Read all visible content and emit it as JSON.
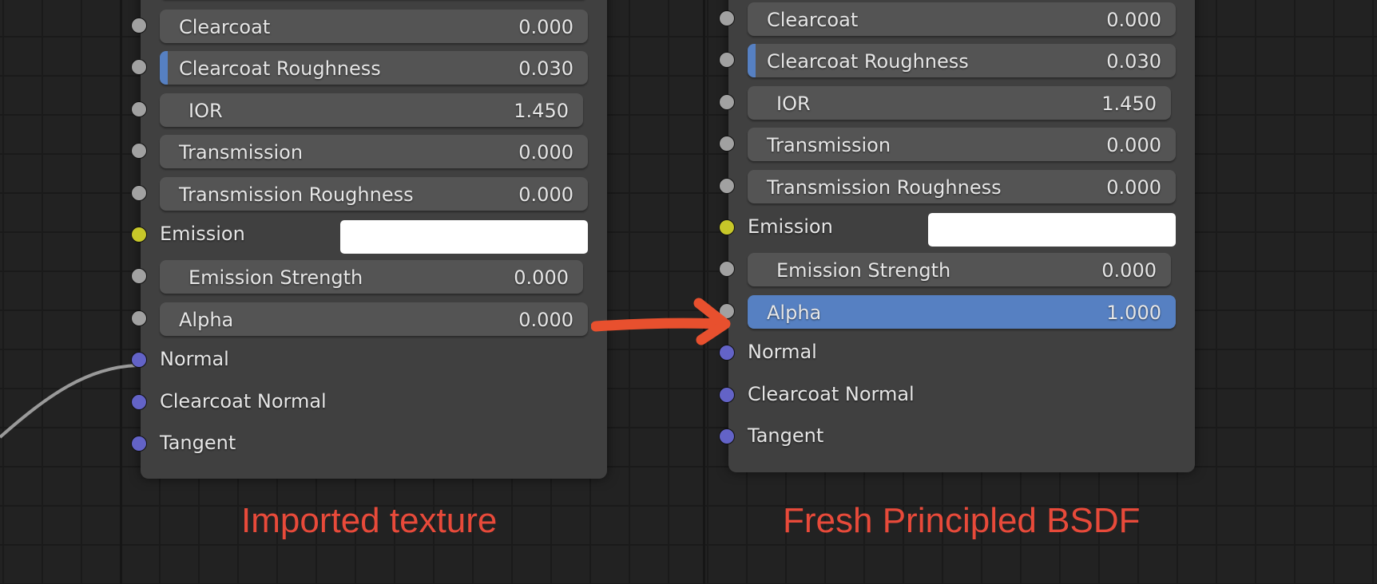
{
  "nodes": [
    {
      "name": "Imported texture node",
      "top_slider_fill_fraction": 0.5,
      "inputs": [
        {
          "label": "Clearcoat",
          "value": "0.000",
          "socket": "gray",
          "kind": "slider",
          "fill": 0.0
        },
        {
          "label": "Clearcoat Roughness",
          "value": "0.030",
          "socket": "gray",
          "kind": "slider",
          "fill": 0.03
        },
        {
          "label": "IOR",
          "value": "1.450",
          "socket": "gray",
          "kind": "number"
        },
        {
          "label": "Transmission",
          "value": "0.000",
          "socket": "gray",
          "kind": "slider",
          "fill": 0.0
        },
        {
          "label": "Transmission Roughness",
          "value": "0.000",
          "socket": "gray",
          "kind": "slider",
          "fill": 0.0
        },
        {
          "label": "Emission",
          "value": "#ffffff",
          "socket": "yellow",
          "kind": "color"
        },
        {
          "label": "Emission Strength",
          "value": "0.000",
          "socket": "gray",
          "kind": "number"
        },
        {
          "label": "Alpha",
          "value": "0.000",
          "socket": "gray",
          "kind": "slider",
          "fill": 0.0
        },
        {
          "label": "Normal",
          "socket": "purple",
          "kind": "vector"
        },
        {
          "label": "Clearcoat Normal",
          "socket": "purple",
          "kind": "vector"
        },
        {
          "label": "Tangent",
          "socket": "purple",
          "kind": "vector"
        }
      ]
    },
    {
      "name": "Fresh Principled BSDF node",
      "top_slider_fill_fraction": 0.5,
      "inputs": [
        {
          "label": "Clearcoat",
          "value": "0.000",
          "socket": "gray",
          "kind": "slider",
          "fill": 0.0
        },
        {
          "label": "Clearcoat Roughness",
          "value": "0.030",
          "socket": "gray",
          "kind": "slider",
          "fill": 0.03
        },
        {
          "label": "IOR",
          "value": "1.450",
          "socket": "gray",
          "kind": "number"
        },
        {
          "label": "Transmission",
          "value": "0.000",
          "socket": "gray",
          "kind": "slider",
          "fill": 0.0
        },
        {
          "label": "Transmission Roughness",
          "value": "0.000",
          "socket": "gray",
          "kind": "slider",
          "fill": 0.0
        },
        {
          "label": "Emission",
          "value": "#ffffff",
          "socket": "yellow",
          "kind": "color"
        },
        {
          "label": "Emission Strength",
          "value": "0.000",
          "socket": "gray",
          "kind": "number"
        },
        {
          "label": "Alpha",
          "value": "1.000",
          "socket": "gray",
          "kind": "slider",
          "fill": 1.0
        },
        {
          "label": "Normal",
          "socket": "purple",
          "kind": "vector"
        },
        {
          "label": "Clearcoat Normal",
          "socket": "purple",
          "kind": "vector"
        },
        {
          "label": "Tangent",
          "socket": "purple",
          "kind": "vector"
        }
      ]
    }
  ],
  "captions": {
    "left": "Imported texture",
    "right": "Fresh Principled BSDF"
  },
  "annotation": {
    "arrow": "red-arrow pointing from left Alpha to right Alpha",
    "color": "#e8502e"
  },
  "colors": {
    "slider_fill": "#5680c2",
    "caption": "#e84a3a",
    "socket_gray": "#a1a1a1",
    "socket_yellow": "#c7c729",
    "socket_purple": "#6363c7"
  }
}
